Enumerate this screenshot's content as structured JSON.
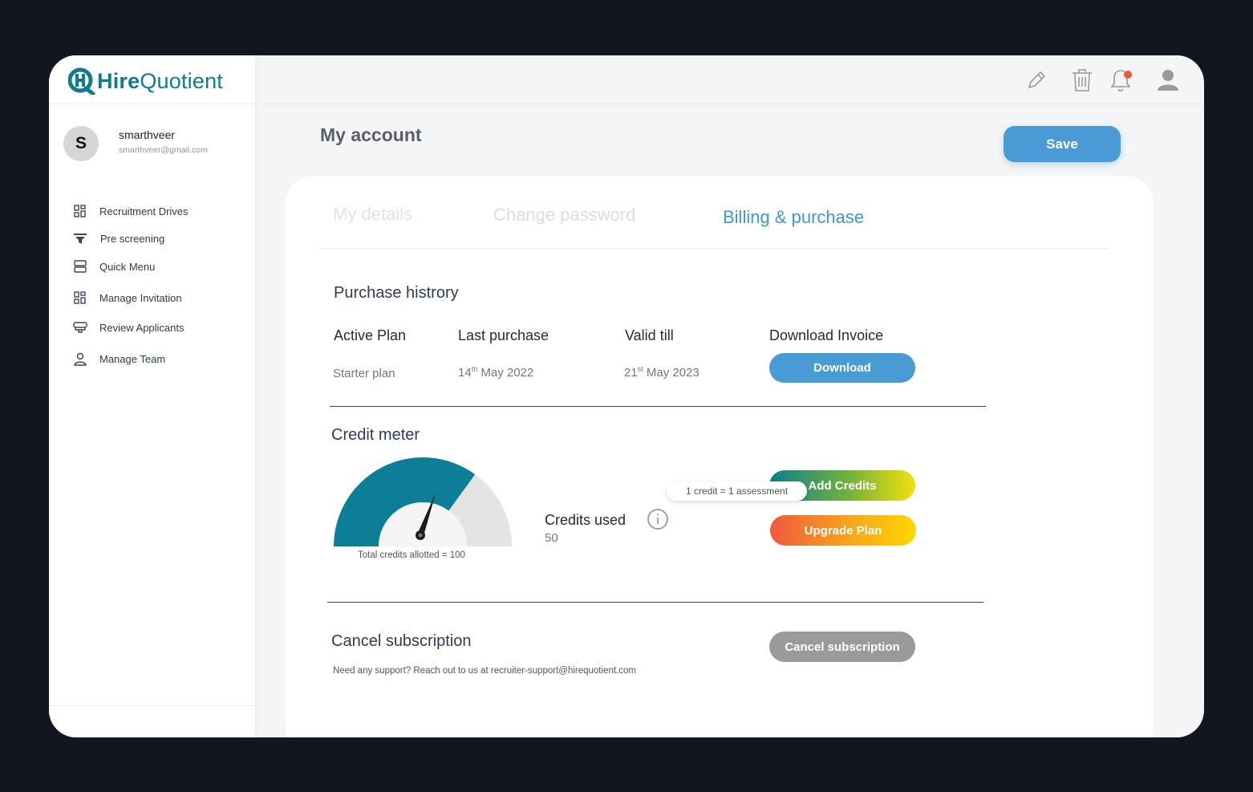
{
  "brand": {
    "name_bold": "Hire",
    "name_light": "Quotient",
    "color": "#0e7c8c"
  },
  "user": {
    "initial": "S",
    "name": "smarthveer",
    "email": "smarthveer@gmail.com"
  },
  "sidebar": {
    "items": [
      {
        "label": "Recruitment Drives",
        "icon": "grid-icon"
      },
      {
        "label": "Pre screening",
        "icon": "filter-icon"
      },
      {
        "label": "Quick Menu",
        "icon": "rows-icon"
      },
      {
        "label": "Manage Invitation",
        "icon": "grid-icon"
      },
      {
        "label": "Review Applicants",
        "icon": "monitor-icon"
      },
      {
        "label": "Manage Team",
        "icon": "person-icon"
      }
    ]
  },
  "topbar": {
    "icons": [
      "pencil-icon",
      "trash-icon",
      "bell-icon",
      "profile-icon"
    ],
    "notification_dot_color": "#f0563c"
  },
  "page": {
    "title": "My account",
    "save_label": "Save"
  },
  "tabs": [
    {
      "label": "My details",
      "active": false
    },
    {
      "label": "Change password",
      "active": false
    },
    {
      "label": "Billing & purchase",
      "active": true
    }
  ],
  "purchase_history": {
    "title": "Purchase histrory",
    "columns": [
      "Active Plan",
      "Last purchase",
      "Valid till",
      "Download Invoice"
    ],
    "row": {
      "plan": "Starter plan",
      "last_purchase": {
        "day": "14",
        "suffix": "th",
        "rest": " May 2022"
      },
      "valid_till": {
        "day": "21",
        "suffix": "st",
        "rest": " May 2023"
      },
      "download_label": "Download"
    }
  },
  "credit_meter": {
    "title": "Credit meter",
    "gauge_caption": "Total credits allotted = 100",
    "total": 100,
    "used": 50,
    "credits_used_label": "Credits used",
    "credits_used_value": "50",
    "tooltip": "1 credit = 1 assessment",
    "add_credits_label": "Add Credits",
    "upgrade_plan_label": "Upgrade Plan"
  },
  "cancel": {
    "title": "Cancel subscription",
    "button_label": "Cancel subscription",
    "support_text": "Need any support? Reach out to us at recruiter-support@hirequotient.com"
  },
  "colors": {
    "accent": "#4a9ad6",
    "teal": "#0c7f97",
    "cancel_gray": "#9a9a9a"
  }
}
